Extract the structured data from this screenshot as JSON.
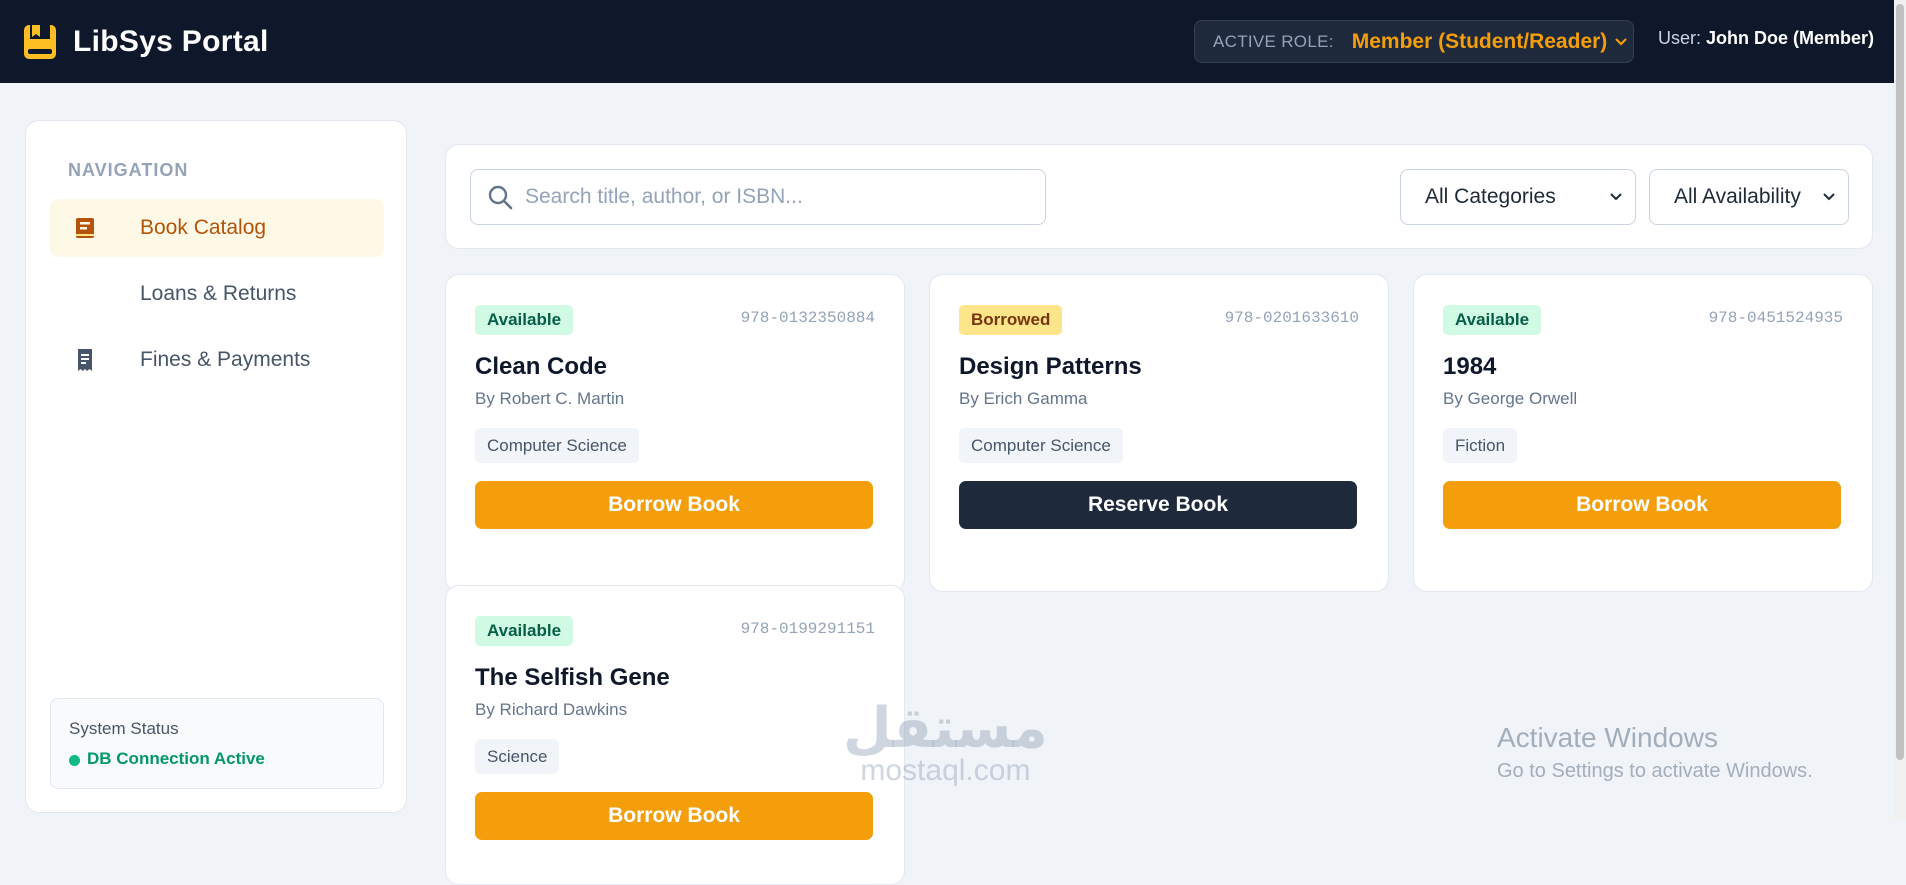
{
  "header": {
    "app_title": "LibSys Portal",
    "role_label": "ACTIVE ROLE:",
    "role_value": "Member (Student/Reader)",
    "user_prefix": "User:",
    "user_name": "John Doe (Member)"
  },
  "sidebar": {
    "heading": "NAVIGATION",
    "items": [
      {
        "label": "Book Catalog",
        "icon": "book-icon",
        "active": true
      },
      {
        "label": "Loans & Returns",
        "icon": "none",
        "active": false
      },
      {
        "label": "Fines & Payments",
        "icon": "receipt-icon",
        "active": false
      }
    ],
    "status": {
      "title": "System Status",
      "text": "DB Connection Active"
    }
  },
  "filters": {
    "search_placeholder": "Search title, author, or ISBN...",
    "category_select": "All Categories",
    "availability_select": "All Availability"
  },
  "books": [
    {
      "status": "Available",
      "isbn": "978-0132350884",
      "title": "Clean Code",
      "author": "By Robert C. Martin",
      "category": "Computer Science",
      "action": "Borrow Book"
    },
    {
      "status": "Borrowed",
      "isbn": "978-0201633610",
      "title": "Design Patterns",
      "author": "By Erich Gamma",
      "category": "Computer Science",
      "action": "Reserve Book"
    },
    {
      "status": "Available",
      "isbn": "978-0451524935",
      "title": "1984",
      "author": "By George Orwell",
      "category": "Fiction",
      "action": "Borrow Book"
    },
    {
      "status": "Available",
      "isbn": "978-0199291151",
      "title": "The Selfish Gene",
      "author": "By Richard Dawkins",
      "category": "Science",
      "action": "Borrow Book"
    }
  ],
  "overlay": {
    "watermark_ar": "مستقل",
    "watermark_en": "mostaql.com",
    "activate_title": "Activate Windows",
    "activate_sub": "Go to Settings to activate Windows."
  },
  "colors": {
    "header_bg": "#0f172a",
    "accent": "#f59e0b",
    "available_bg": "#d1fae5",
    "borrowed_bg": "#fde68a",
    "reserve_bg": "#1e293b"
  }
}
